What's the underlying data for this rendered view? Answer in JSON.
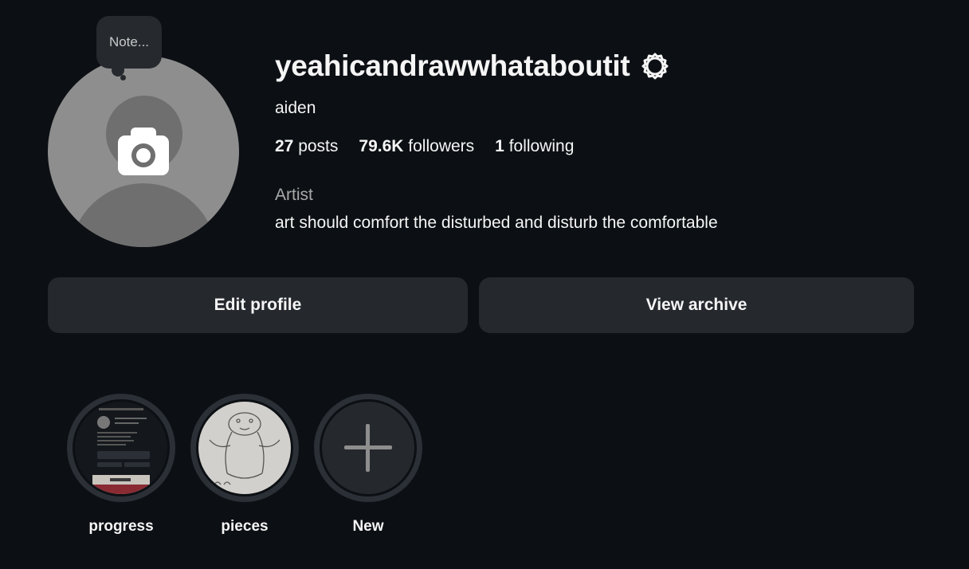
{
  "note": {
    "placeholder": "Note..."
  },
  "profile": {
    "username": "yeahicandrawwhataboutit",
    "display_name": "aiden",
    "category": "Artist",
    "bio": "art should comfort the disturbed and disturb the comfortable"
  },
  "stats": {
    "posts": {
      "count": "27",
      "label": "posts"
    },
    "followers": {
      "count": "79.6K",
      "label": "followers"
    },
    "following": {
      "count": "1",
      "label": "following"
    }
  },
  "actions": {
    "edit_profile": "Edit profile",
    "view_archive": "View archive"
  },
  "highlights": [
    {
      "label": "progress",
      "icon": "profile-screenshot-thumbnail"
    },
    {
      "label": "pieces",
      "icon": "drawing-thumbnail"
    },
    {
      "label": "New",
      "icon": "plus-icon"
    }
  ],
  "icons": {
    "settings": "gear-icon",
    "avatar_upload": "camera-icon"
  },
  "colors": {
    "background": "#0c1014",
    "surface": "#25292e",
    "text_primary": "#f5f5f5",
    "text_secondary": "#a8a8a8",
    "avatar_placeholder": "#8e8e8e"
  }
}
